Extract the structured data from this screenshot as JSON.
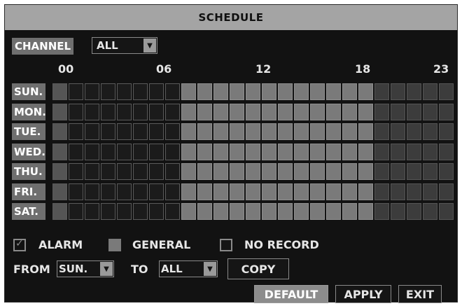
{
  "title": "SCHEDULE",
  "channel": {
    "label": "CHANNEL",
    "value": "ALL"
  },
  "hours": [
    "00",
    "06",
    "12",
    "18",
    "23"
  ],
  "days": [
    {
      "label": "SUN."
    },
    {
      "label": "MON."
    },
    {
      "label": "TUE."
    },
    {
      "label": "WED."
    },
    {
      "label": "THU."
    },
    {
      "label": "FRI."
    },
    {
      "label": "SAT."
    }
  ],
  "schedule_modes_by_hour": [
    "alarm",
    "alarm",
    "alarm",
    "alarm",
    "alarm",
    "alarm",
    "alarm",
    "alarm",
    "general",
    "general",
    "general",
    "general",
    "general",
    "general",
    "general",
    "general",
    "general",
    "general",
    "general",
    "general",
    "norecord",
    "norecord",
    "norecord",
    "norecord",
    "norecord"
  ],
  "legend": {
    "alarm": "ALARM",
    "general": "GENERAL",
    "norecord": "NO RECORD"
  },
  "copy": {
    "from_label": "FROM",
    "from_value": "SUN.",
    "to_label": "TO",
    "to_value": "ALL",
    "copy_button": "COPY"
  },
  "buttons": {
    "default": "DEFAULT",
    "apply": "APPLY",
    "exit": "EXIT"
  },
  "colors": {
    "background": "#121212",
    "title_bar": "#a4a4a4",
    "general": "#7a7a7a",
    "no_record": "#3c3c3c"
  }
}
